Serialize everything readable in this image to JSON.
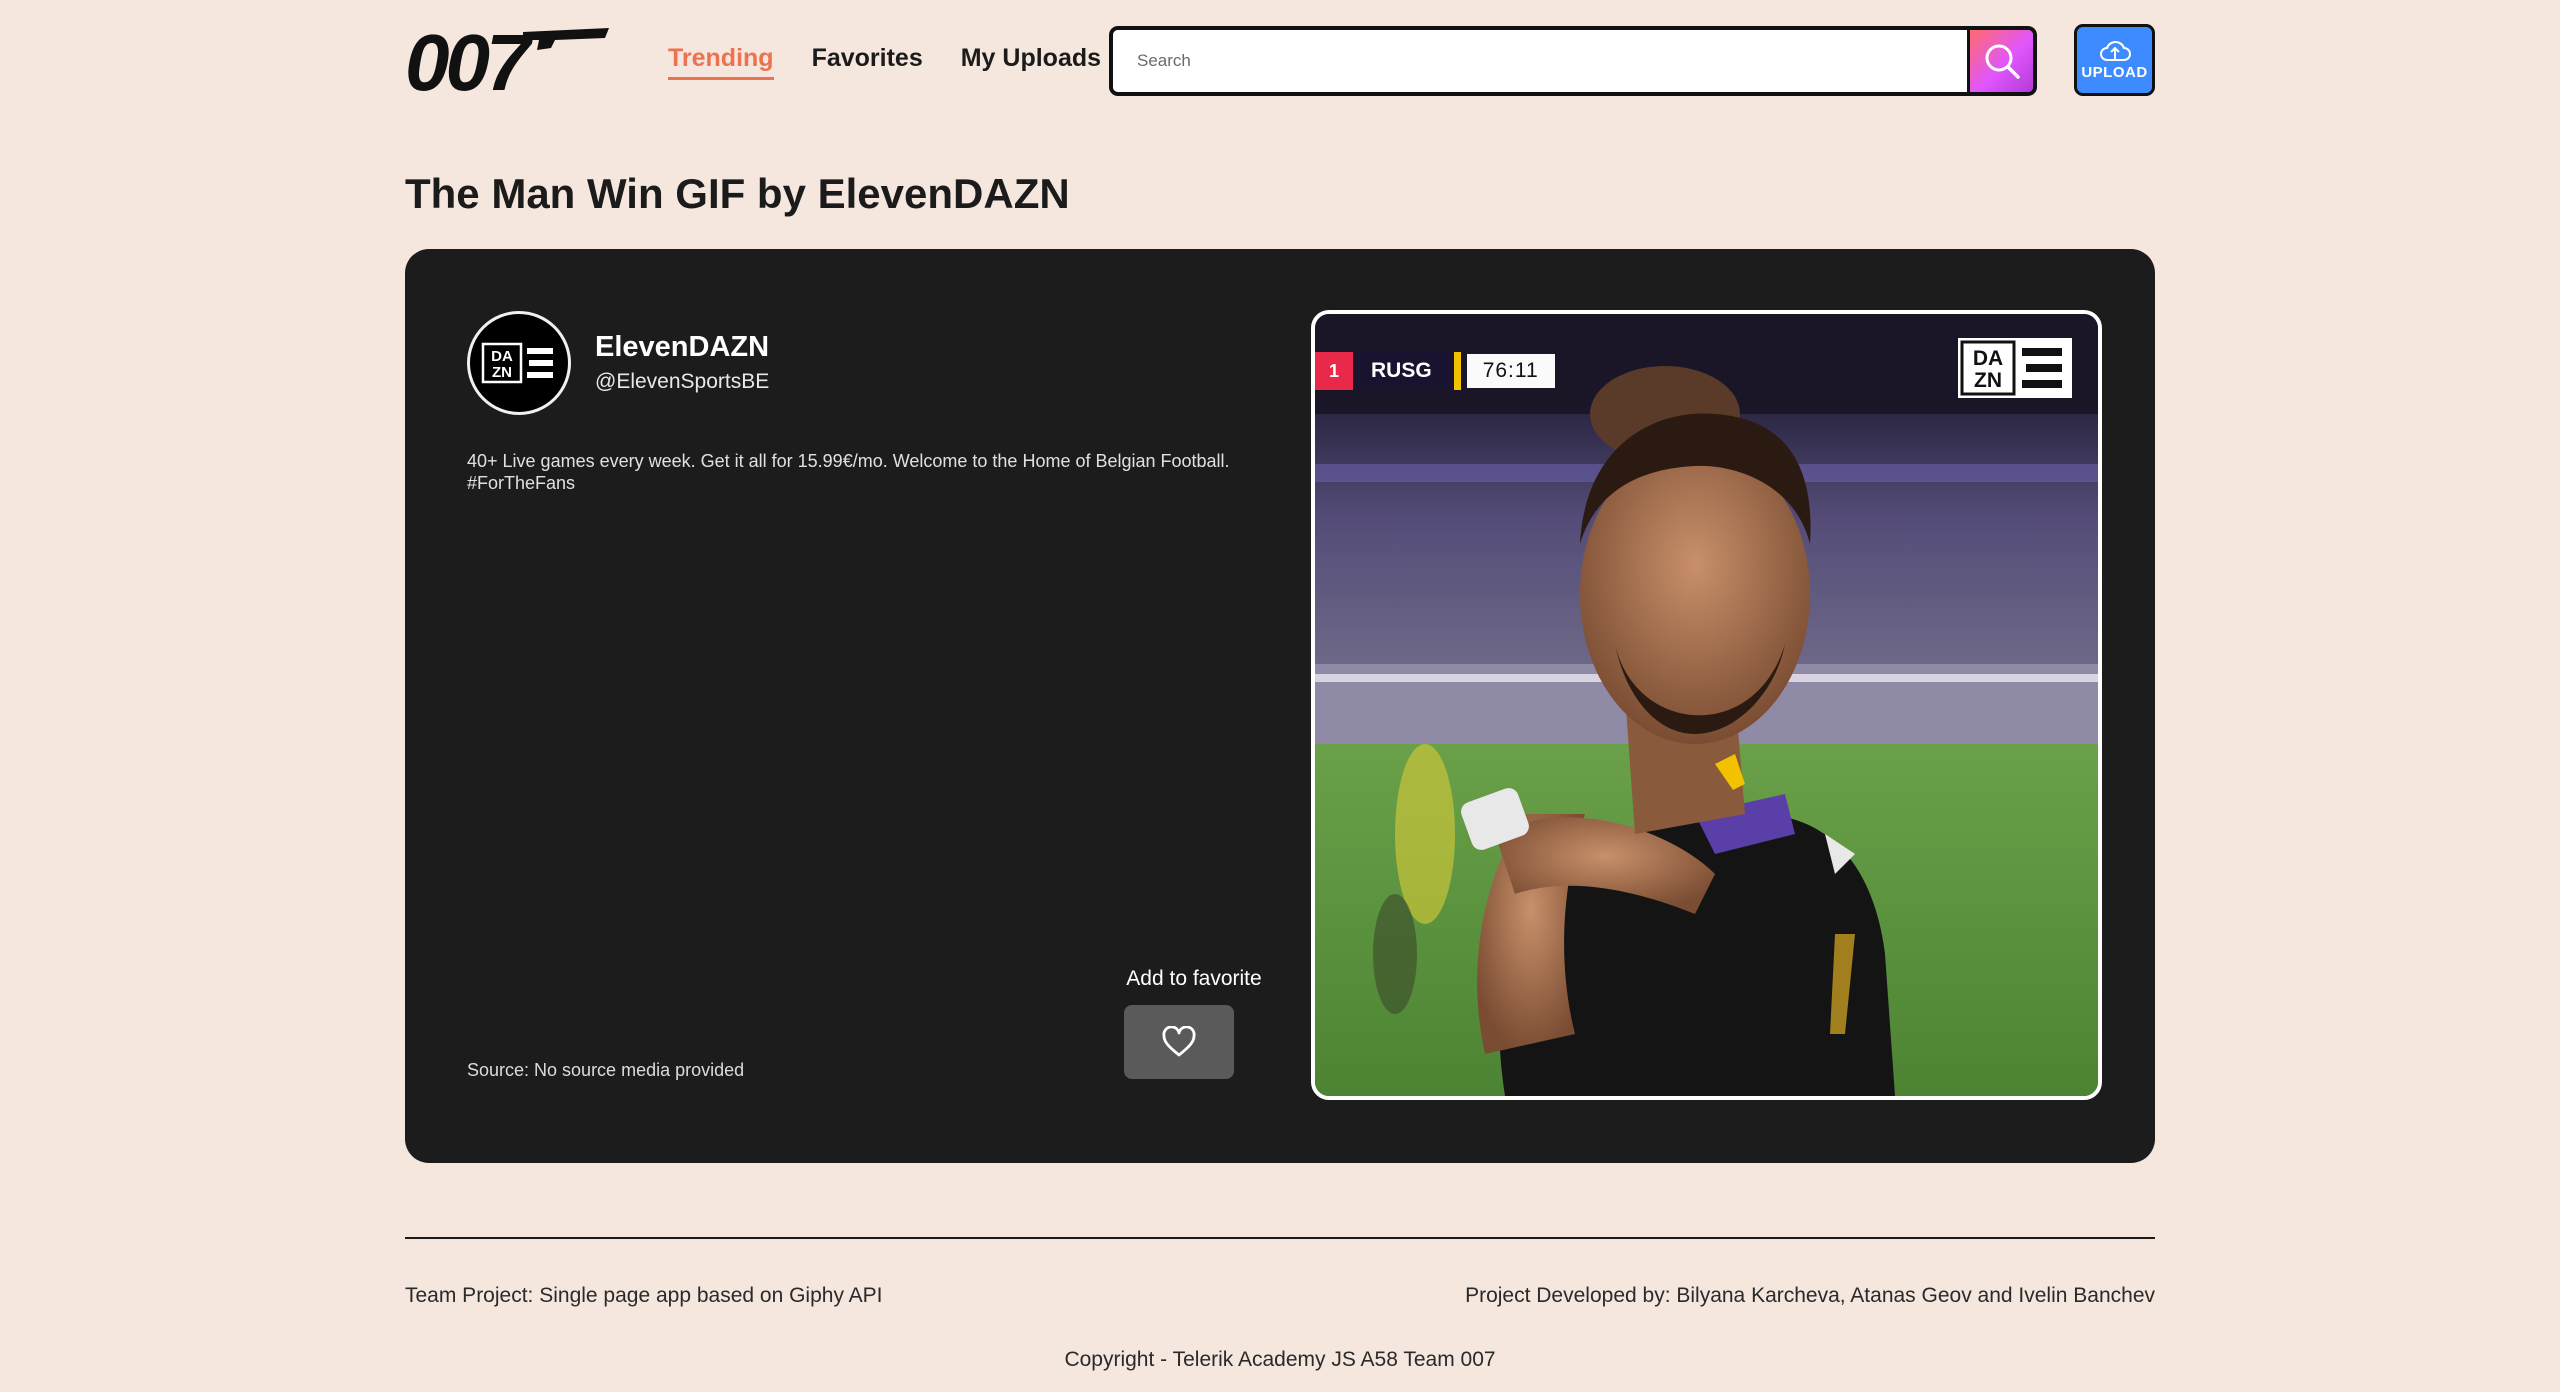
{
  "header": {
    "logo_text": "007",
    "nav": [
      {
        "label": "Trending",
        "active": true
      },
      {
        "label": "Favorites",
        "active": false
      },
      {
        "label": "My Uploads",
        "active": false
      }
    ],
    "search": {
      "placeholder": "Search",
      "value": "",
      "icon": "search-icon"
    },
    "upload": {
      "label": "UPLOAD",
      "icon": "cloud-upload-icon"
    }
  },
  "page": {
    "title": "The Man Win GIF by ElevenDAZN"
  },
  "gif": {
    "user": {
      "display_name": "ElevenDAZN",
      "handle": "@ElevenSportsBE",
      "description": "40+ Live games every week. Get it all for 15.99€/mo. Welcome to the Home of Belgian Football. #ForTheFans",
      "avatar_text": "DAZN"
    },
    "source": "Source: No source media provided",
    "favorite": {
      "label": "Add to favorite",
      "icon": "heart-icon"
    },
    "media": {
      "scorebug_number": "1",
      "scorebug_team": "RUSG",
      "scorebug_time": "76:11",
      "broadcaster_logo": "DAZN"
    }
  },
  "footer": {
    "left": "Team Project: Single page app based on Giphy API",
    "right": "Project Developed by: Bilyana Karcheva, Atanas Geov and Ivelin Banchev",
    "copyright": "Copyright - Telerik Academy JS A58 Team 007"
  },
  "colors": {
    "background": "#f5e6de",
    "accent": "#ec7250",
    "card": "#1c1c1c",
    "upload": "#3d8bff"
  }
}
